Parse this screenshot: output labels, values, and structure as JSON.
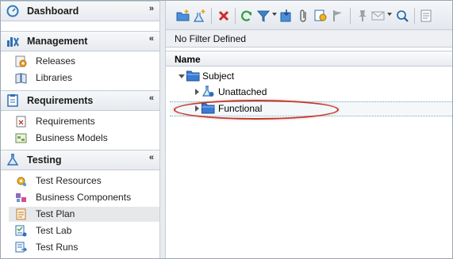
{
  "sidebar": {
    "dashboard": {
      "title": "Dashboard",
      "chevron": "»"
    },
    "management": {
      "title": "Management",
      "chevron": "«",
      "items": [
        {
          "label": "Releases"
        },
        {
          "label": "Libraries"
        }
      ]
    },
    "requirements": {
      "title": "Requirements",
      "chevron": "«",
      "items": [
        {
          "label": "Requirements"
        },
        {
          "label": "Business Models"
        }
      ]
    },
    "testing": {
      "title": "Testing",
      "chevron": "«",
      "items": [
        {
          "label": "Test Resources"
        },
        {
          "label": "Business Components"
        },
        {
          "label": "Test Plan",
          "selected": true
        },
        {
          "label": "Test Lab"
        },
        {
          "label": "Test Runs"
        }
      ]
    }
  },
  "main": {
    "filter_text": "No Filter Defined",
    "column_header": "Name",
    "tree": {
      "root": {
        "label": "Subject",
        "expanded": true
      },
      "children": [
        {
          "label": "Unattached",
          "expanded": false
        },
        {
          "label": "Functional",
          "expanded": false,
          "selected": true,
          "highlighted": true
        }
      ]
    }
  },
  "toolbar_icons": [
    "new-folder-icon",
    "new-test-icon",
    "delete-icon",
    "refresh-icon",
    "filter-icon",
    "move-icon",
    "attachments-icon",
    "copy-url-icon",
    "flag-icon",
    "pin-icon",
    "send-mail-icon",
    "find-icon",
    "comments-icon"
  ],
  "colors": {
    "highlight_ring": "#c0392b",
    "folder_blue": "#3a7bd5",
    "selected_nav": "#e7e8ea"
  }
}
